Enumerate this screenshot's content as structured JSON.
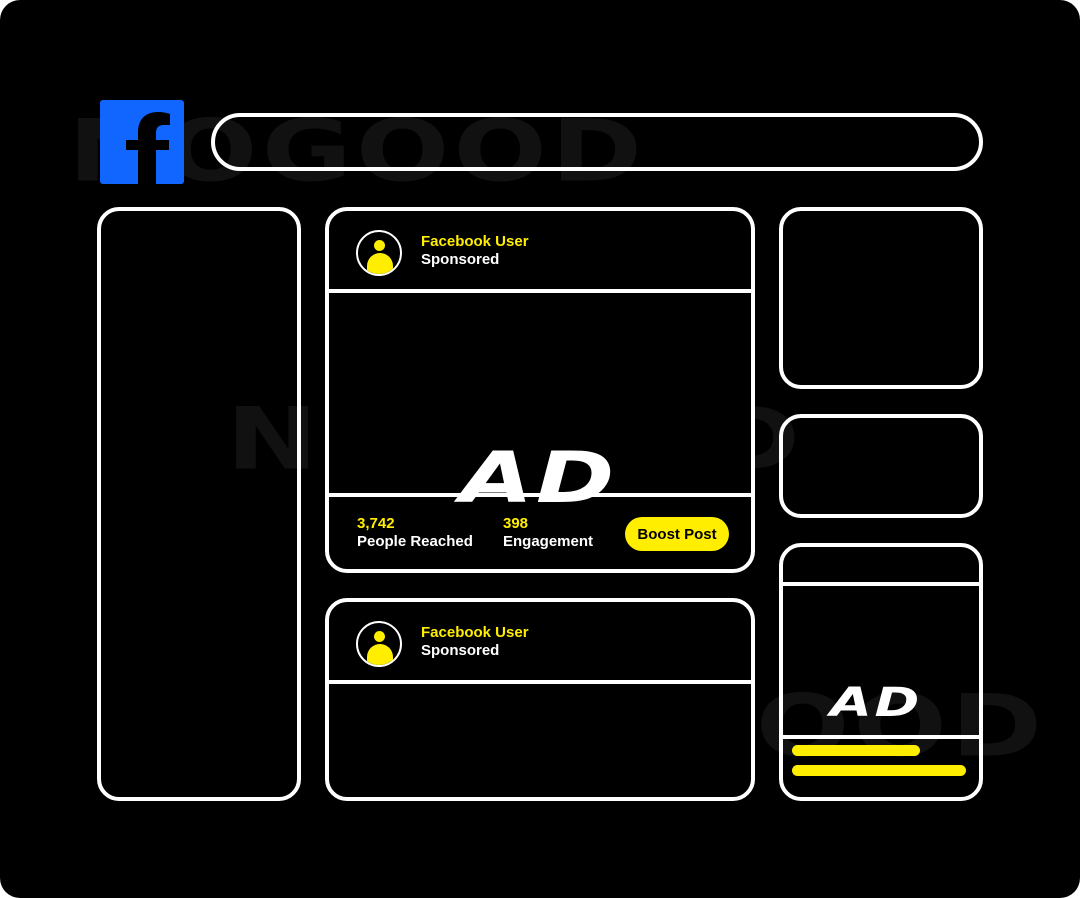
{
  "watermark": {
    "text": "NOGOOD"
  },
  "header": {
    "logo_icon": "facebook-f-icon",
    "brand_color": "#1066ff",
    "search": {
      "value": "",
      "placeholder": ""
    }
  },
  "colors": {
    "accent": "#ffee00",
    "outline": "#ffffff",
    "background": "#000000"
  },
  "feed": {
    "posts": [
      {
        "user": "Facebook User",
        "label": "Sponsored",
        "media_text": "AD",
        "stats": [
          {
            "value": "3,742",
            "label": "People Reached"
          },
          {
            "value": "398",
            "label": "Engagement"
          }
        ],
        "action": "Boost Post"
      },
      {
        "user": "Facebook User",
        "label": "Sponsored"
      }
    ]
  },
  "right_rail": {
    "ad_card": {
      "media_text": "AD"
    }
  }
}
